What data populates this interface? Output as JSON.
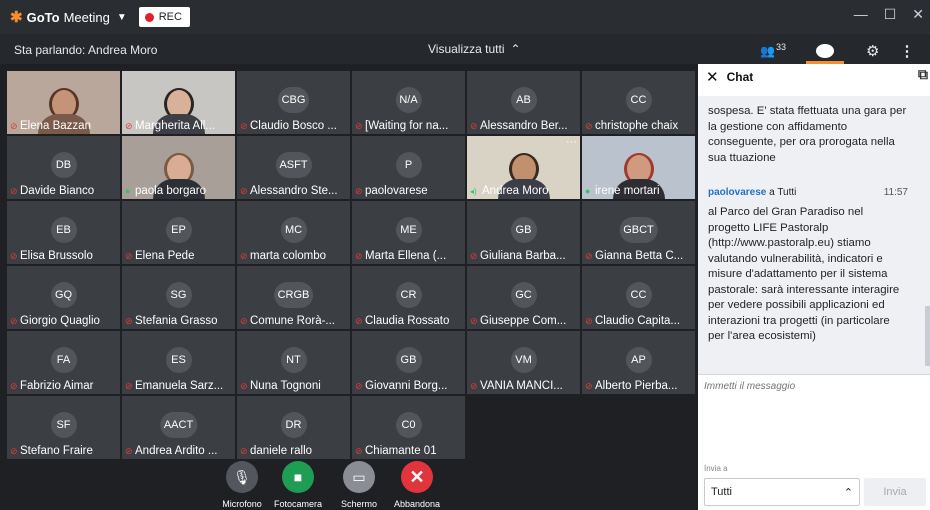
{
  "window": {
    "brand_bold": "GoTo",
    "brand_light": "Meeting",
    "rec_label": "REC",
    "controls": {
      "minimize": "—",
      "maximize": "☐",
      "close": "✕"
    }
  },
  "toolbar": {
    "speaking": "Sta parlando: Andrea Moro",
    "view_all": "Visualizza tutti",
    "participants_count": "33"
  },
  "participants": [
    {
      "name": "Elena Bazzan",
      "initials": "",
      "video": true,
      "mic": "muted",
      "skin": "#c59478",
      "hair": "#5a3526",
      "shirt": "#7a5a4a",
      "bg": "#b9a79c"
    },
    {
      "name": "Margherita All...",
      "initials": "",
      "video": true,
      "mic": "muted",
      "skin": "#d8b19a",
      "hair": "#2a2422",
      "shirt": "#3c3f46",
      "bg": "#c8c6c2"
    },
    {
      "name": "Claudio Bosco ...",
      "initials": "CBG",
      "video": false,
      "mic": "muted"
    },
    {
      "name": "[Waiting for na...",
      "initials": "N/A",
      "video": false,
      "mic": "muted"
    },
    {
      "name": "Alessandro Ber...",
      "initials": "AB",
      "video": false,
      "mic": "muted"
    },
    {
      "name": "christophe chaix",
      "initials": "CC",
      "video": false,
      "mic": "muted"
    },
    {
      "name": "Davide Bianco",
      "initials": "DB",
      "video": false,
      "mic": "muted"
    },
    {
      "name": "paola borgaro",
      "initials": "",
      "video": true,
      "mic": "on",
      "skin": "#d9ad94",
      "hair": "#7a5a42",
      "shirt": "#2d2f36",
      "bg": "#a79f98"
    },
    {
      "name": "Alessandro Ste...",
      "initials": "ASFT",
      "video": false,
      "mic": "muted"
    },
    {
      "name": "paolovarese",
      "initials": "P",
      "video": false,
      "mic": "muted"
    },
    {
      "name": "Andrea Moro",
      "initials": "",
      "video": true,
      "mic": "speaking",
      "skin": "#c0906f",
      "hair": "#3a2a22",
      "shirt": "#3b3e48",
      "bg": "#d9d3c6"
    },
    {
      "name": "irene mortari",
      "initials": "",
      "video": true,
      "mic": "on",
      "skin": "#cf9a80",
      "hair": "#a03a2a",
      "shirt": "#2d2d33",
      "bg": "#b9c2cd"
    },
    {
      "name": "Elisa Brussolo",
      "initials": "EB",
      "video": false,
      "mic": "muted"
    },
    {
      "name": "Elena Pede",
      "initials": "EP",
      "video": false,
      "mic": "muted"
    },
    {
      "name": "marta colombo",
      "initials": "MC",
      "video": false,
      "mic": "muted"
    },
    {
      "name": "Marta Ellena (...",
      "initials": "ME",
      "video": false,
      "mic": "muted"
    },
    {
      "name": "Giuliana Barba...",
      "initials": "GB",
      "video": false,
      "mic": "muted"
    },
    {
      "name": "Gianna Betta C...",
      "initials": "GBCT",
      "video": false,
      "mic": "muted"
    },
    {
      "name": "Giorgio Quaglio",
      "initials": "GQ",
      "video": false,
      "mic": "muted"
    },
    {
      "name": "Stefania Grasso",
      "initials": "SG",
      "video": false,
      "mic": "muted"
    },
    {
      "name": "Comune Rorà-...",
      "initials": "CRGB",
      "video": false,
      "mic": "muted"
    },
    {
      "name": "Claudia Rossato",
      "initials": "CR",
      "video": false,
      "mic": "muted"
    },
    {
      "name": "Giuseppe Com...",
      "initials": "GC",
      "video": false,
      "mic": "muted"
    },
    {
      "name": "Claudio Capita...",
      "initials": "CC",
      "video": false,
      "mic": "muted"
    },
    {
      "name": "Fabrizio Aimar",
      "initials": "FA",
      "video": false,
      "mic": "muted"
    },
    {
      "name": "Emanuela Sarz...",
      "initials": "ES",
      "video": false,
      "mic": "muted"
    },
    {
      "name": "Nuna Tognoni",
      "initials": "NT",
      "video": false,
      "mic": "muted"
    },
    {
      "name": "Giovanni Borg...",
      "initials": "GB",
      "video": false,
      "mic": "muted"
    },
    {
      "name": "VANIA MANCI...",
      "initials": "VM",
      "video": false,
      "mic": "muted"
    },
    {
      "name": "Alberto Pierba...",
      "initials": "AP",
      "video": false,
      "mic": "muted"
    },
    {
      "name": "Stefano Fraire",
      "initials": "SF",
      "video": false,
      "mic": "muted"
    },
    {
      "name": "Andrea Ardito ...",
      "initials": "AACT",
      "video": false,
      "mic": "muted"
    },
    {
      "name": "daniele rallo",
      "initials": "DR",
      "video": false,
      "mic": "muted"
    },
    {
      "name": "Chiamante 01",
      "initials": "C0",
      "video": false,
      "mic": "muted"
    }
  ],
  "meeting_controls": [
    {
      "name": "mic-button",
      "icon": "microphone-muted-icon",
      "glyph": "🎙",
      "label": "Microfono",
      "color": "#53565c"
    },
    {
      "name": "camera-button",
      "icon": "camera-icon",
      "glyph": "■",
      "label": "Fotocamera",
      "color": "#1f9d55"
    },
    {
      "name": "screen-button",
      "icon": "screen-share-icon",
      "glyph": "▭",
      "label": "Schermo",
      "color": "#8a8d93"
    },
    {
      "name": "leave-button",
      "icon": "close-icon",
      "glyph": "✕",
      "label": "Abbandona",
      "color": "#e0353d"
    }
  ],
  "chat": {
    "title": "Chat",
    "previous_message_tail": "sospesa. E' stata ffettuata una gara per la gestione con affidamento conseguente, per ora prorogata nella sua ttuazione",
    "last_message": {
      "sender": "paolovarese",
      "to": "a Tutti",
      "time": "11:57",
      "text": "al Parco del Gran Paradiso nel progetto LIFE Pastoralp (http://www.pastoralp.eu) stiamo valutando vulnerabilità, indicatori e misure d'adattamento per il sistema pastorale: sarà interessante interagire per vedere possibili applicazioni ed interazioni tra progetti (in particolare per l'area ecosistemi)"
    },
    "input_placeholder": "Immetti il messaggio",
    "send_to_label": "Invia a",
    "recipient": "Tutti",
    "send_label": "Invia"
  },
  "colors": {
    "accent": "#f68d2e",
    "muted_mic": "#e23b3b",
    "active_mic": "#34c46a",
    "link": "#2470c7"
  }
}
